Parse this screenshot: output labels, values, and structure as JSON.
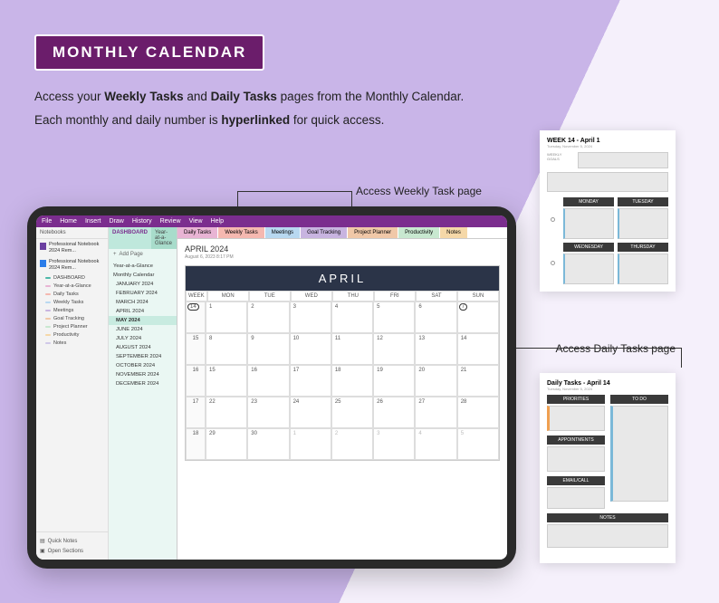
{
  "badge": "MONTHLY CALENDAR",
  "desc_l1a": "Access your ",
  "desc_l1b": "Weekly Tasks",
  "desc_l1c": " and ",
  "desc_l1d": "Daily Tasks",
  "desc_l1e": " pages from the Monthly Calendar.",
  "desc_l2a": "Each monthly and daily number is ",
  "desc_l2b": "hyperlinked",
  "desc_l2c": " for quick access.",
  "callout_weekly": "Access Weekly Task page",
  "callout_daily": "Access Daily Tasks page",
  "menu": [
    "File",
    "Home",
    "Insert",
    "Draw",
    "History",
    "Review",
    "View",
    "Help"
  ],
  "nb": {
    "header": "Notebooks",
    "items": [
      {
        "icon": "p",
        "label": "Professional Notebook 2024 Rem..."
      },
      {
        "icon": "b",
        "label": "Professional Notebook 2024 Rem..."
      }
    ],
    "sections": [
      {
        "c": "#4db8a8",
        "l": "DASHBOARD"
      },
      {
        "c": "#e8b4d4",
        "l": "Year-at-a-Glance"
      },
      {
        "c": "#f5b8b0",
        "l": "Daily Tasks"
      },
      {
        "c": "#b8d8f0",
        "l": "Weekly Tasks"
      },
      {
        "c": "#c8b4e0",
        "l": "Meetings"
      },
      {
        "c": "#f0c8a8",
        "l": "Goal Tracking"
      },
      {
        "c": "#c8e8d0",
        "l": "Project Planner"
      },
      {
        "c": "#f5d8a8",
        "l": "Productivity"
      },
      {
        "c": "#d0c8e8",
        "l": "Notes"
      }
    ],
    "foot": [
      "Quick Notes",
      "Open Sections"
    ]
  },
  "pagecol": {
    "tabA": "DASHBOARD",
    "tabB": "Year-at-a-Glance",
    "add": "Add Page",
    "items": [
      "Year-at-a-Glance",
      "Monthly Calendar",
      "JANUARY 2024",
      "FEBRUARY 2024",
      "MARCH 2024",
      "APRIL 2024",
      "MAY 2024",
      "JUNE 2024",
      "JULY 2024",
      "AUGUST 2024",
      "SEPTEMBER 2024",
      "OCTOBER 2024",
      "NOVEMBER 2024",
      "DECEMBER 2024"
    ],
    "selected": "MAY 2024"
  },
  "tabs": [
    "Daily Tasks",
    "Weekly Tasks",
    "Meetings",
    "Goal Tracking",
    "Project Planner",
    "Productivity",
    "Notes"
  ],
  "page": {
    "title": "APRIL 2024",
    "date": "August 6, 2023     8:17 PM"
  },
  "cal": {
    "banner": "APRIL",
    "headers": [
      "WEEK",
      "MON",
      "TUE",
      "WED",
      "THU",
      "FRI",
      "SAT",
      "SUN"
    ],
    "rows": [
      {
        "wk": "14",
        "d": [
          "1",
          "2",
          "3",
          "4",
          "5",
          "6",
          "7"
        ]
      },
      {
        "wk": "15",
        "d": [
          "8",
          "9",
          "10",
          "11",
          "12",
          "13",
          "14"
        ]
      },
      {
        "wk": "16",
        "d": [
          "15",
          "16",
          "17",
          "18",
          "19",
          "20",
          "21"
        ]
      },
      {
        "wk": "17",
        "d": [
          "22",
          "23",
          "24",
          "25",
          "26",
          "27",
          "28"
        ]
      },
      {
        "wk": "18",
        "d": [
          "29",
          "30",
          "1",
          "2",
          "3",
          "4",
          "5"
        ]
      }
    ]
  },
  "pv1": {
    "title": "WEEK 14 - April 1",
    "days": [
      "MONDAY",
      "TUESDAY",
      "WEDNESDAY",
      "THURSDAY"
    ]
  },
  "pv2": {
    "title": "Daily Tasks - April 14",
    "bands": [
      "PRIORITIES",
      "TO DO",
      "APPOINTMENTS",
      "EMAIL/CALL",
      "NOTES"
    ]
  }
}
